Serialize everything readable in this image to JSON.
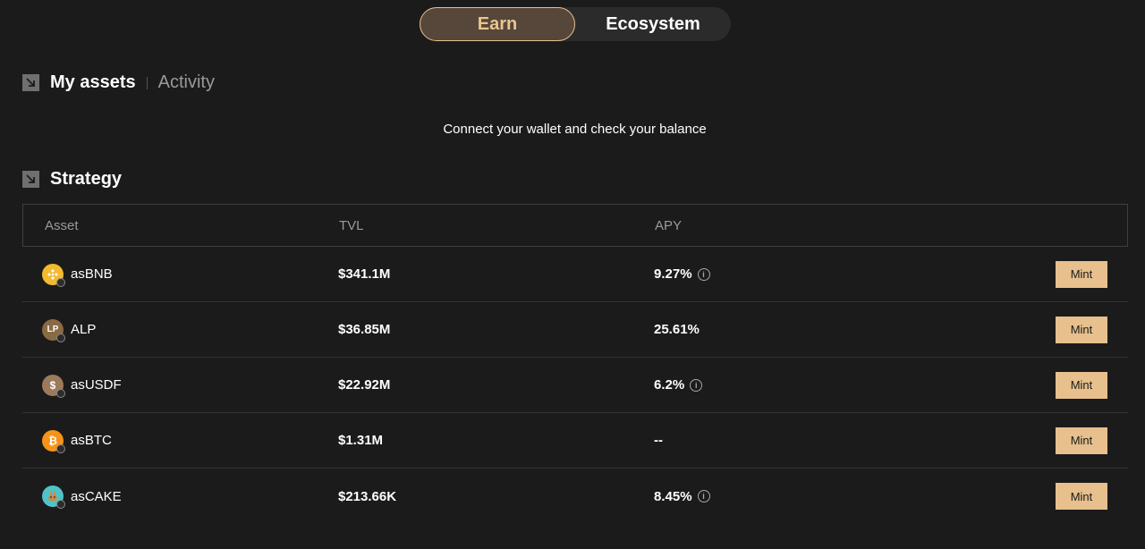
{
  "nav": {
    "tabs": [
      {
        "label": "Earn",
        "active": true
      },
      {
        "label": "Ecosystem",
        "active": false
      }
    ]
  },
  "assets_section": {
    "title": "My assets",
    "alt_tab": "Activity",
    "message": "Connect your wallet and check your balance"
  },
  "strategy_section": {
    "title": "Strategy",
    "columns": [
      "Asset",
      "TVL",
      "APY"
    ],
    "action_label": "Mint",
    "rows": [
      {
        "asset": "asBNB",
        "tvl": "$341.1M",
        "apy": "9.27%",
        "has_info": true,
        "icon": "bnb-coin-icon",
        "color": "#f3ba2f"
      },
      {
        "asset": "ALP",
        "tvl": "$36.85M",
        "apy": "25.61%",
        "has_info": false,
        "icon": "alp-coin-icon",
        "color": "#8a6a44"
      },
      {
        "asset": "asUSDF",
        "tvl": "$22.92M",
        "apy": "6.2%",
        "has_info": true,
        "icon": "usdf-coin-icon",
        "color": "#9c7a5a"
      },
      {
        "asset": "asBTC",
        "tvl": "$1.31M",
        "apy": "--",
        "has_info": false,
        "icon": "btc-coin-icon",
        "color": "#f7931a"
      },
      {
        "asset": "asCAKE",
        "tvl": "$213.66K",
        "apy": "8.45%",
        "has_info": true,
        "icon": "cake-coin-icon",
        "color": "#4fc3c8"
      }
    ]
  },
  "colors": {
    "accent": "#e7c08d",
    "background": "#1b1b1b"
  }
}
